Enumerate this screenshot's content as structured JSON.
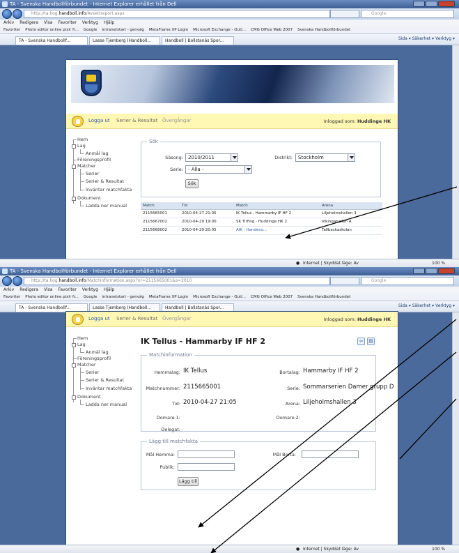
{
  "window1": {
    "title": "TA - Svenska Handbollförbundet - Internet Explorer erhållet från Dell",
    "address_prefix": "http://ta.hog.",
    "address_host": "handboll.info",
    "address_suffix": "/Avsettreport.aspx",
    "search_placeholder": "Google",
    "menu": [
      "Arkiv",
      "Redigera",
      "Visa",
      "Favoriter",
      "Verktyg",
      "Hjälp"
    ],
    "favorites": [
      "Favoriter",
      "Photo editor online pixlr fr...",
      "Google",
      "intranetstart - genväg",
      "MetaFrame XP Login",
      "Microsoft Exchange - Outl...",
      "CMG Office Web 2007",
      "Svenska Handbollförbundet"
    ],
    "tabs": [
      "TA - Svenska Handbollf...",
      "Lasse Tjemberg (Handboll...",
      "Handboll | Bollstanäs Spor..."
    ],
    "cmdbar": "Sida ▾  Säkerhet ▾  Verktyg ▾",
    "status": "Internet | Skyddat läge: Av",
    "zoom": "100 %",
    "topnav": {
      "logout": "Logga ut",
      "series": "Serier & Resultat",
      "transfers": "Övergångar",
      "logged_in_label": "Inloggad som:",
      "logged_in_user": "Huddinge HK"
    },
    "tree": [
      "Hem",
      "Lag",
      "Anmäl lag",
      "Föreningsprofil",
      "Matcher",
      "Serier",
      "Serier & Resultat",
      "Inväntar matchfakta",
      "Dokument",
      "Ladda ner manual"
    ],
    "search": {
      "legend": "Sök",
      "season_label": "Säsong:",
      "season_value": "2010/2011",
      "district_label": "Distrikt:",
      "district_value": "Stockholm",
      "series_label": "Serie:",
      "series_value": "- Alla -",
      "button": "Sök"
    },
    "table": {
      "headers": [
        "Match",
        "Tid",
        "Match",
        "Arena"
      ],
      "rows": [
        [
          "2115665001",
          "2010-04-27 21:05",
          "IK Tellus - Hammarby IF HF 2",
          "Liljeholmshallen 3"
        ],
        [
          "2115667002",
          "2010-04-29 19:00",
          "SK Tirfing - Huddinge HK 2",
          "Vikingahallen A"
        ],
        [
          "2115668002",
          "2010-04-29 20:05",
          "AIK - Handens...",
          "Tallbackaskolan"
        ]
      ]
    }
  },
  "window2": {
    "title": "TA - Svenska Handbollförbundet - Internet Explorer erhållet från Dell",
    "address_prefix": "http://ta.hog.",
    "address_host": "handboll.info",
    "address_suffix": "/Matchinformation.aspx?nr=2115665001&s=2010",
    "search_placeholder": "Google",
    "menu": [
      "Arkiv",
      "Redigera",
      "Visa",
      "Favoriter",
      "Verktyg",
      "Hjälp"
    ],
    "favorites": [
      "Favoriter",
      "Photo editor online pixlr fr...",
      "Google",
      "intranetstart - genväg",
      "MetaFrame XP Login",
      "Microsoft Exchange - Outl...",
      "CMG Office Web 2007",
      "Svenska Handbollförbundet"
    ],
    "tabs": [
      "TA - Svenska Handbollf...",
      "Lasse Tjemberg (Handboll...",
      "Handboll | Bollstanäs Spor..."
    ],
    "cmdbar": "Sida ▾  Säkerhet ▾  Verktyg ▾",
    "topnav": {
      "logout": "Logga ut",
      "series": "Serier & Resultat",
      "transfers": "Övergångar",
      "logged_in_label": "Inloggad som:",
      "logged_in_user": "Huddinge HK"
    },
    "tree": [
      "Hem",
      "Lag",
      "Anmäl lag",
      "Föreningsprofil",
      "Matcher",
      "Serier",
      "Serier & Resultat",
      "Inväntar matchfakta",
      "Dokument",
      "Ladda ner manual"
    ],
    "page_title": "IK Tellus - Hammarby IF HF 2",
    "matchinfo": {
      "legend": "Matchinformation",
      "home_label": "Hemmalag:",
      "home_value": "IK Tellus",
      "away_label": "Bortalag:",
      "away_value": "Hammarby IF HF 2",
      "matchno_label": "Matchnummer:",
      "matchno_value": "2115665001",
      "series_label": "Serie:",
      "series_value": "Sommarserien Damer grupp D",
      "time_label": "Tid:",
      "time_value": "2010-04-27 21:05",
      "arena_label": "Arena:",
      "arena_value": "Liljeholmshallen 3",
      "ref1_label": "Domare 1:",
      "ref2_label": "Domare 2:",
      "delegate_label": "Delegat:"
    },
    "matchfacts": {
      "legend": "Lägg till matchfakta",
      "home_goals_label": "Mål Hemma:",
      "away_goals_label": "Mål Borta:",
      "audience_label": "Publik:",
      "button": "Lägg till"
    },
    "status": "Internet | Skyddat läge: Av",
    "zoom": "100 %"
  },
  "colors": {
    "browser_chrome": "#4a6a9c",
    "top_nav": "#fff7b3",
    "table_header": "#d9e3f2",
    "link": "#3060a8"
  }
}
